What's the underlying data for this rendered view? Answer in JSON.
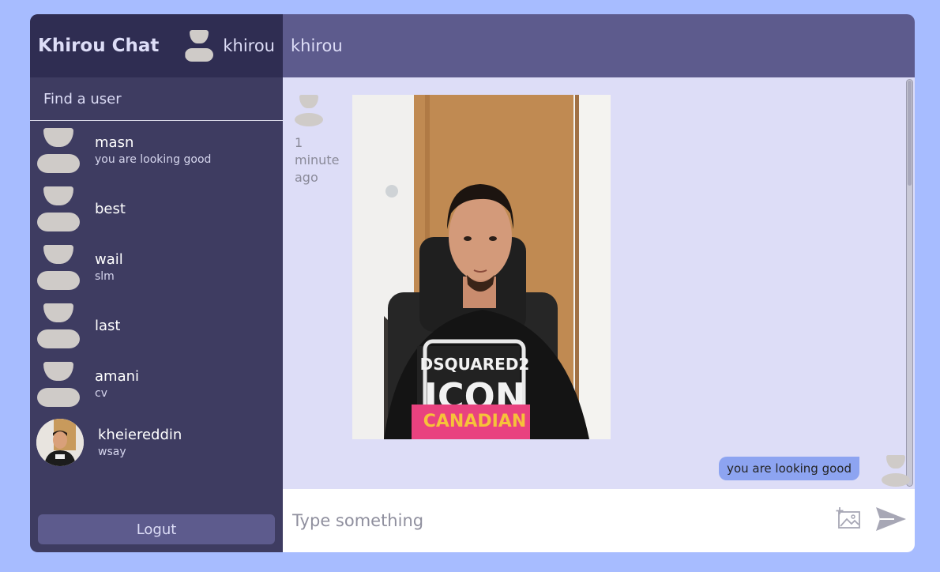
{
  "sidebar": {
    "logo": "Khirou Chat",
    "current_user": "khirou",
    "search_placeholder": "Find a user",
    "chats": [
      {
        "name": "masn",
        "last_message": "you are looking good",
        "avatar": "default"
      },
      {
        "name": "best",
        "last_message": "",
        "avatar": "default"
      },
      {
        "name": "wail",
        "last_message": "slm",
        "avatar": "default"
      },
      {
        "name": "last",
        "last_message": "",
        "avatar": "default"
      },
      {
        "name": "amani",
        "last_message": "cv",
        "avatar": "default"
      },
      {
        "name": "kheiereddin",
        "last_message": "wsay",
        "avatar": "photo"
      }
    ],
    "logout_label": "Logut"
  },
  "chat": {
    "title": "khirou",
    "messages": [
      {
        "side": "left",
        "time": "1 minute ago",
        "type": "image"
      },
      {
        "side": "right",
        "text": "you are looking good",
        "type": "text"
      }
    ],
    "input_placeholder": "Type something"
  },
  "colors": {
    "background": "#a7bcff",
    "sidebar": "#3e3c61",
    "sidebar_header": "#2f2d52",
    "chat_header": "#5d5b8d",
    "messages_bg": "#ddddf7",
    "owner_bubble": "#8da4f1"
  }
}
